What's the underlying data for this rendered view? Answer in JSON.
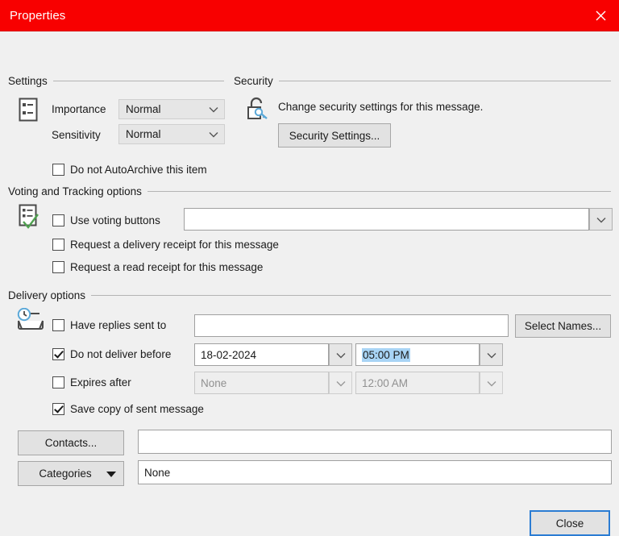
{
  "window": {
    "title": "Properties",
    "close_icon": "close-x-icon",
    "accent_color": "#f80000"
  },
  "groups": {
    "settings": {
      "label": "Settings",
      "icon": "settings-list-icon"
    },
    "security": {
      "label": "Security",
      "icon": "padlock-key-icon"
    },
    "voting": {
      "label": "Voting and Tracking options",
      "icon": "clipboard-check-icon"
    },
    "delivery": {
      "label": "Delivery options",
      "icon": "inbox-clock-icon"
    }
  },
  "settings": {
    "importance_label": "Importance",
    "importance_value": "Normal",
    "sensitivity_label": "Sensitivity",
    "sensitivity_value": "Normal",
    "autoarchive_label": "Do not AutoArchive this item",
    "autoarchive_checked": false
  },
  "security": {
    "description": "Change security settings for this message.",
    "settings_button": "Security Settings..."
  },
  "voting": {
    "use_voting_label": "Use voting buttons",
    "use_voting_checked": false,
    "voting_value": "",
    "delivery_receipt_label": "Request a delivery receipt for this message",
    "delivery_receipt_checked": false,
    "read_receipt_label": "Request a read receipt for this message",
    "read_receipt_checked": false
  },
  "delivery": {
    "have_replies_label": "Have replies sent to",
    "have_replies_checked": false,
    "have_replies_value": "",
    "select_names_button": "Select Names...",
    "not_before_label": "Do not deliver before",
    "not_before_checked": true,
    "not_before_date": "18-02-2024",
    "not_before_time": "05:00 PM",
    "expires_label": "Expires after",
    "expires_checked": false,
    "expires_date": "None",
    "expires_time": "12:00 AM",
    "save_copy_label": "Save copy of sent message",
    "save_copy_checked": true
  },
  "bottom": {
    "contacts_button": "Contacts...",
    "contacts_value": "",
    "categories_button": "Categories",
    "categories_value": "None"
  },
  "footer": {
    "close_button": "Close"
  }
}
